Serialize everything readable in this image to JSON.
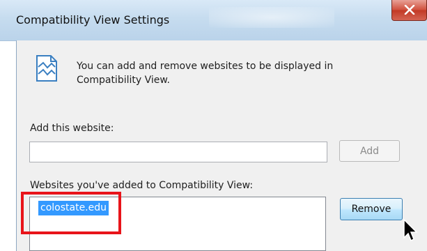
{
  "window": {
    "title": "Compatibility View Settings"
  },
  "info": {
    "text": "You can add and remove websites to be displayed in Compatibility View."
  },
  "add_section": {
    "label": "Add this website:",
    "input_value": "",
    "add_button": "Add"
  },
  "list_section": {
    "label": "Websites you've added to Compatibility View:",
    "items": [
      "colostate.edu"
    ],
    "remove_button": "Remove"
  },
  "colors": {
    "highlight": "#e8141a",
    "selection": "#3399ff",
    "close_button": "#c23a26"
  },
  "icons": {
    "close": "close-icon",
    "info": "compatibility-view-icon",
    "cursor": "mouse-pointer-icon"
  }
}
